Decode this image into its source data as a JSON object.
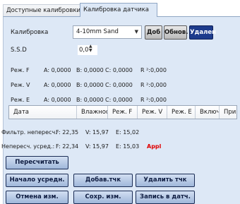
{
  "tabs": [
    {
      "label": "Доступные калибровки"
    },
    {
      "label": "Калибровка датчика"
    }
  ],
  "calibration": {
    "label": "Калибровка",
    "selected": "4-10mm Sand",
    "btn_add": "Доб",
    "btn_refresh": "Обнов.",
    "btn_delete": "Удален"
  },
  "ssd": {
    "label": "S.S.D",
    "value": "0,0"
  },
  "modes": [
    {
      "name": "Реж. F",
      "a": "A: 0,0000",
      "b": "B: 0,0000",
      "c": "C: 0,0000",
      "r": "R ²:0,000"
    },
    {
      "name": "Реж. V",
      "a": "A: 0,0000",
      "b": "B: 0,0000",
      "c": "C: 0,0000",
      "r": "R ²:0,000"
    },
    {
      "name": "Реж. E",
      "a": "A: 0,0000",
      "b": "B: 0,0000",
      "c": "C: 0,0000",
      "r": "R ²:0,000"
    }
  ],
  "table": {
    "columns": [
      "Дата",
      "Влажнос",
      "Реж. F",
      "Реж. V",
      "Реж. E",
      "Включ.",
      "Прим"
    ]
  },
  "filtered": {
    "label": "Фильтр. непересч.",
    "f": "F: 22,35",
    "v": "V: 15,97",
    "e": "E: 15,02"
  },
  "averaged": {
    "label": "Непересч. усред.:",
    "f": "F: 22,34",
    "v": "V: 15,97",
    "e": "E: 15,03",
    "tag": "Appl"
  },
  "buttons": {
    "recalc": "Пересчитать",
    "start_avg": "Начало усредн.",
    "add_point": "Добав.тчк",
    "delete_point": "Удалить тчк",
    "cancel": "Отмена изм.",
    "save": "Сохр. изм.",
    "write": "Запись в датч."
  },
  "colors": {
    "panel": "#dde8f6",
    "selected_button": "#1d3b8c",
    "warning": "#e00000"
  }
}
